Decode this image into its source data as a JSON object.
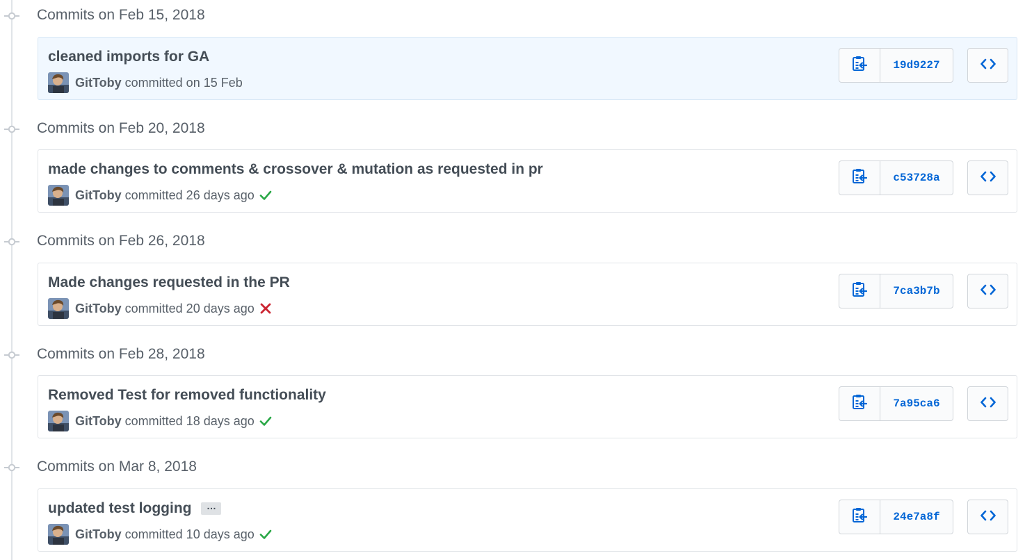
{
  "colors": {
    "link": "#0366d6",
    "success": "#28a745",
    "failure": "#cb2431",
    "highlight": "#f1f8ff"
  },
  "groups": [
    {
      "title": "Commits on Feb 15, 2018",
      "commit": {
        "message": "cleaned imports for GA",
        "author": "GitToby",
        "committed": "committed on 15 Feb",
        "status": "none",
        "sha": "19d9227",
        "has_ellipsis": false,
        "highlighted": true
      }
    },
    {
      "title": "Commits on Feb 20, 2018",
      "commit": {
        "message": "made changes to comments & crossover & mutation as requested in pr",
        "author": "GitToby",
        "committed": "committed 26 days ago",
        "status": "success",
        "sha": "c53728a",
        "has_ellipsis": false,
        "highlighted": false
      }
    },
    {
      "title": "Commits on Feb 26, 2018",
      "commit": {
        "message": "Made changes requested in the PR",
        "author": "GitToby",
        "committed": "committed 20 days ago",
        "status": "failure",
        "sha": "7ca3b7b",
        "has_ellipsis": false,
        "highlighted": false
      }
    },
    {
      "title": "Commits on Feb 28, 2018",
      "commit": {
        "message": "Removed Test for removed functionality",
        "author": "GitToby",
        "committed": "committed 18 days ago",
        "status": "success",
        "sha": "7a95ca6",
        "has_ellipsis": false,
        "highlighted": false
      }
    },
    {
      "title": "Commits on Mar 8, 2018",
      "commit": {
        "message": "updated test logging",
        "author": "GitToby",
        "committed": "committed 10 days ago",
        "status": "success",
        "sha": "24e7a8f",
        "has_ellipsis": true,
        "ellipsis_label": "…",
        "highlighted": false
      }
    }
  ],
  "icons": {
    "timeline_node": "git-commit-icon",
    "copy": "clippy-icon",
    "browse": "code-icon",
    "success": "check-icon",
    "failure": "x-icon",
    "avatar": "user-avatar"
  }
}
